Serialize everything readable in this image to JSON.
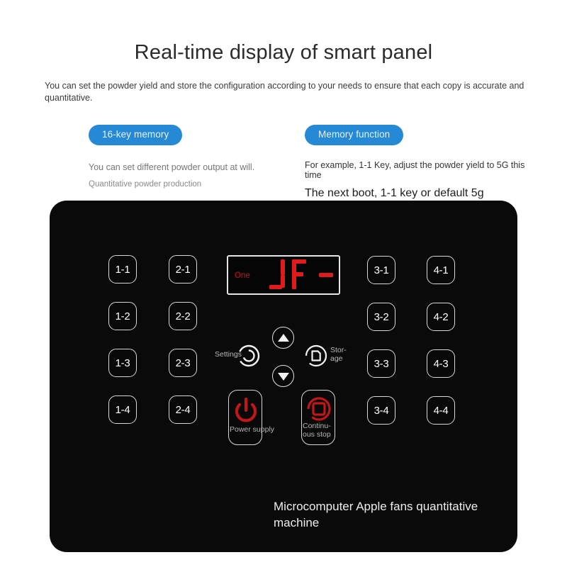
{
  "header": {
    "title": "Real-time display of smart panel",
    "intro": "You can set the powder yield and store the configuration according to your needs to ensure that each copy is accurate and quantitative."
  },
  "features": {
    "left": {
      "badge": "16-key memory",
      "line1": "You can set different powder output at will.",
      "line2": "Quantitative powder production"
    },
    "right": {
      "badge": "Memory function",
      "line1": "For example, 1-1 Key, adjust the powder yield to 5G this time",
      "line2": "The next boot, 1-1 key or default 5g"
    }
  },
  "panel": {
    "keys": [
      {
        "label": "1-1"
      },
      {
        "label": "1-2"
      },
      {
        "label": "1-3"
      },
      {
        "label": "1-4"
      },
      {
        "label": "2-1"
      },
      {
        "label": "2-2"
      },
      {
        "label": "2-3"
      },
      {
        "label": "2-4"
      },
      {
        "label": "3-1"
      },
      {
        "label": "3-2"
      },
      {
        "label": "3-3"
      },
      {
        "label": "3-4"
      },
      {
        "label": "4-1"
      },
      {
        "label": "4-2"
      },
      {
        "label": "4-3"
      },
      {
        "label": "4-4"
      }
    ],
    "display": {
      "label": "One",
      "value": "JF -"
    },
    "controls": {
      "settings_label": "Settings",
      "storage_label": "Stor-\nage",
      "up_icon": "triangle-up-icon",
      "down_icon": "triangle-down-icon",
      "power_label": "Power supply",
      "stop_label": "Continu-\nous stop"
    },
    "brand": "Microcomputer Apple fans quantitative machine"
  },
  "colors": {
    "badge_blue": "#2589d6",
    "panel_black": "#0a0a0a",
    "led_red": "#e01b1b",
    "icon_red": "#c01818"
  }
}
